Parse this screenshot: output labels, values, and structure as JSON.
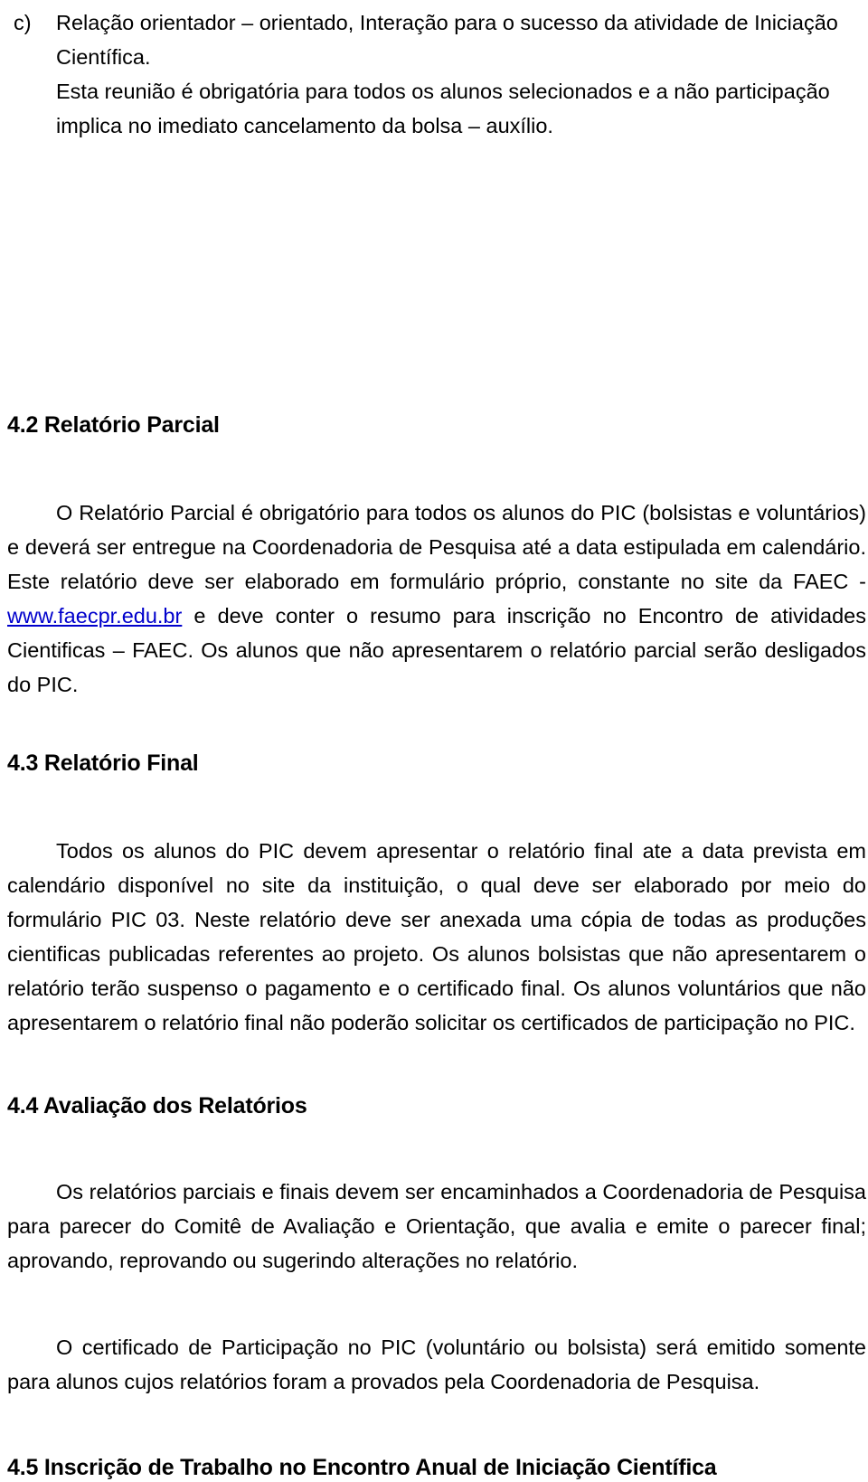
{
  "document": {
    "language": "pt-BR",
    "text_color": "#000000",
    "background_color": "#ffffff",
    "link_color": "#0000CC"
  },
  "list_item_c": {
    "marker": "c)",
    "text": "Relação orientador – orientado, Interação para o sucesso da atividade de Iniciação Científica.",
    "continuation": "Esta reunião é obrigatória para todos os alunos selecionados e a não participação implica no imediato cancelamento da bolsa – auxílio."
  },
  "sections": {
    "s42": {
      "heading": "4.2 Relatório Parcial",
      "paragraph_before_link": "O Relatório Parcial é obrigatório para todos os alunos do PIC (bolsistas e voluntários) e deverá ser entregue na Coordenadoria de Pesquisa até a data estipulada em calendário. Este relatório deve ser elaborado em formulário próprio, constante no site da FAEC - ",
      "link_text": "www.faecpr.edu.br",
      "paragraph_after_link": " e deve conter o resumo para inscrição no Encontro de atividades Cientificas – FAEC. Os alunos que não apresentarem o relatório parcial serão desligados do PIC."
    },
    "s43": {
      "heading": "4.3 Relatório Final",
      "paragraph": "Todos os alunos do PIC devem apresentar o relatório final ate a data prevista em calendário disponível no site da instituição, o qual deve ser elaborado por meio do formulário PIC 03. Neste relatório deve ser anexada uma cópia de todas as produções cientificas publicadas referentes ao projeto. Os alunos bolsistas que não apresentarem o relatório terão suspenso o pagamento e o certificado final. Os alunos voluntários que não apresentarem o relatório final não poderão solicitar os certificados de participação no PIC."
    },
    "s44": {
      "heading": "4.4 Avaliação dos Relatórios",
      "paragraph_1": "Os relatórios parciais e finais devem ser encaminhados a Coordenadoria de Pesquisa para parecer do Comitê de Avaliação e Orientação, que avalia e emite o parecer final; aprovando, reprovando ou sugerindo alterações no relatório.",
      "paragraph_2": "O certificado de Participação no PIC (voluntário ou bolsista) será emitido somente para alunos cujos relatórios foram a provados pela Coordenadoria de Pesquisa."
    },
    "s45": {
      "heading": "4.5 Inscrição de Trabalho no Encontro Anual de Iniciação Científica"
    }
  }
}
